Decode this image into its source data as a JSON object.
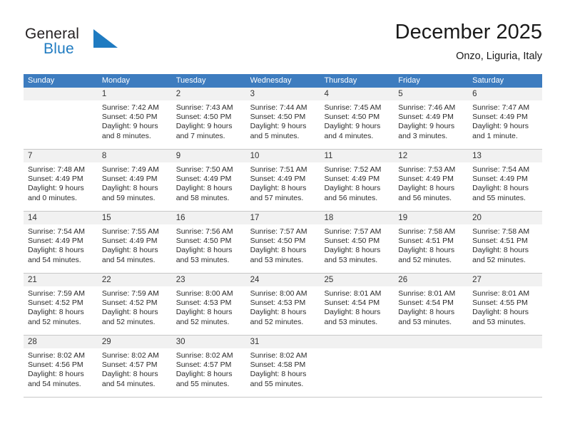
{
  "brand": {
    "name_top": "General",
    "name_bottom": "Blue",
    "mark": "triangle-logo-icon",
    "color_dark": "#231f20",
    "color_blue": "#1f7bc1"
  },
  "header": {
    "title": "December 2025",
    "subtitle": "Onzo, Liguria, Italy"
  },
  "theme": {
    "header_bg": "#3d7cbf",
    "header_text": "#ffffff",
    "daynum_bg": "#f1f1f1",
    "grid_line": "#c8c8c8"
  },
  "weekdays": [
    "Sunday",
    "Monday",
    "Tuesday",
    "Wednesday",
    "Thursday",
    "Friday",
    "Saturday"
  ],
  "weeks": [
    {
      "days": [
        {
          "num": "",
          "lines": [
            "",
            "",
            "",
            ""
          ]
        },
        {
          "num": "1",
          "lines": [
            "Sunrise: 7:42 AM",
            "Sunset: 4:50 PM",
            "Daylight: 9 hours",
            "and 8 minutes."
          ]
        },
        {
          "num": "2",
          "lines": [
            "Sunrise: 7:43 AM",
            "Sunset: 4:50 PM",
            "Daylight: 9 hours",
            "and 7 minutes."
          ]
        },
        {
          "num": "3",
          "lines": [
            "Sunrise: 7:44 AM",
            "Sunset: 4:50 PM",
            "Daylight: 9 hours",
            "and 5 minutes."
          ]
        },
        {
          "num": "4",
          "lines": [
            "Sunrise: 7:45 AM",
            "Sunset: 4:50 PM",
            "Daylight: 9 hours",
            "and 4 minutes."
          ]
        },
        {
          "num": "5",
          "lines": [
            "Sunrise: 7:46 AM",
            "Sunset: 4:49 PM",
            "Daylight: 9 hours",
            "and 3 minutes."
          ]
        },
        {
          "num": "6",
          "lines": [
            "Sunrise: 7:47 AM",
            "Sunset: 4:49 PM",
            "Daylight: 9 hours",
            "and 1 minute."
          ]
        }
      ]
    },
    {
      "days": [
        {
          "num": "7",
          "lines": [
            "Sunrise: 7:48 AM",
            "Sunset: 4:49 PM",
            "Daylight: 9 hours",
            "and 0 minutes."
          ]
        },
        {
          "num": "8",
          "lines": [
            "Sunrise: 7:49 AM",
            "Sunset: 4:49 PM",
            "Daylight: 8 hours",
            "and 59 minutes."
          ]
        },
        {
          "num": "9",
          "lines": [
            "Sunrise: 7:50 AM",
            "Sunset: 4:49 PM",
            "Daylight: 8 hours",
            "and 58 minutes."
          ]
        },
        {
          "num": "10",
          "lines": [
            "Sunrise: 7:51 AM",
            "Sunset: 4:49 PM",
            "Daylight: 8 hours",
            "and 57 minutes."
          ]
        },
        {
          "num": "11",
          "lines": [
            "Sunrise: 7:52 AM",
            "Sunset: 4:49 PM",
            "Daylight: 8 hours",
            "and 56 minutes."
          ]
        },
        {
          "num": "12",
          "lines": [
            "Sunrise: 7:53 AM",
            "Sunset: 4:49 PM",
            "Daylight: 8 hours",
            "and 56 minutes."
          ]
        },
        {
          "num": "13",
          "lines": [
            "Sunrise: 7:54 AM",
            "Sunset: 4:49 PM",
            "Daylight: 8 hours",
            "and 55 minutes."
          ]
        }
      ]
    },
    {
      "days": [
        {
          "num": "14",
          "lines": [
            "Sunrise: 7:54 AM",
            "Sunset: 4:49 PM",
            "Daylight: 8 hours",
            "and 54 minutes."
          ]
        },
        {
          "num": "15",
          "lines": [
            "Sunrise: 7:55 AM",
            "Sunset: 4:49 PM",
            "Daylight: 8 hours",
            "and 54 minutes."
          ]
        },
        {
          "num": "16",
          "lines": [
            "Sunrise: 7:56 AM",
            "Sunset: 4:50 PM",
            "Daylight: 8 hours",
            "and 53 minutes."
          ]
        },
        {
          "num": "17",
          "lines": [
            "Sunrise: 7:57 AM",
            "Sunset: 4:50 PM",
            "Daylight: 8 hours",
            "and 53 minutes."
          ]
        },
        {
          "num": "18",
          "lines": [
            "Sunrise: 7:57 AM",
            "Sunset: 4:50 PM",
            "Daylight: 8 hours",
            "and 53 minutes."
          ]
        },
        {
          "num": "19",
          "lines": [
            "Sunrise: 7:58 AM",
            "Sunset: 4:51 PM",
            "Daylight: 8 hours",
            "and 52 minutes."
          ]
        },
        {
          "num": "20",
          "lines": [
            "Sunrise: 7:58 AM",
            "Sunset: 4:51 PM",
            "Daylight: 8 hours",
            "and 52 minutes."
          ]
        }
      ]
    },
    {
      "days": [
        {
          "num": "21",
          "lines": [
            "Sunrise: 7:59 AM",
            "Sunset: 4:52 PM",
            "Daylight: 8 hours",
            "and 52 minutes."
          ]
        },
        {
          "num": "22",
          "lines": [
            "Sunrise: 7:59 AM",
            "Sunset: 4:52 PM",
            "Daylight: 8 hours",
            "and 52 minutes."
          ]
        },
        {
          "num": "23",
          "lines": [
            "Sunrise: 8:00 AM",
            "Sunset: 4:53 PM",
            "Daylight: 8 hours",
            "and 52 minutes."
          ]
        },
        {
          "num": "24",
          "lines": [
            "Sunrise: 8:00 AM",
            "Sunset: 4:53 PM",
            "Daylight: 8 hours",
            "and 52 minutes."
          ]
        },
        {
          "num": "25",
          "lines": [
            "Sunrise: 8:01 AM",
            "Sunset: 4:54 PM",
            "Daylight: 8 hours",
            "and 53 minutes."
          ]
        },
        {
          "num": "26",
          "lines": [
            "Sunrise: 8:01 AM",
            "Sunset: 4:54 PM",
            "Daylight: 8 hours",
            "and 53 minutes."
          ]
        },
        {
          "num": "27",
          "lines": [
            "Sunrise: 8:01 AM",
            "Sunset: 4:55 PM",
            "Daylight: 8 hours",
            "and 53 minutes."
          ]
        }
      ]
    },
    {
      "days": [
        {
          "num": "28",
          "lines": [
            "Sunrise: 8:02 AM",
            "Sunset: 4:56 PM",
            "Daylight: 8 hours",
            "and 54 minutes."
          ]
        },
        {
          "num": "29",
          "lines": [
            "Sunrise: 8:02 AM",
            "Sunset: 4:57 PM",
            "Daylight: 8 hours",
            "and 54 minutes."
          ]
        },
        {
          "num": "30",
          "lines": [
            "Sunrise: 8:02 AM",
            "Sunset: 4:57 PM",
            "Daylight: 8 hours",
            "and 55 minutes."
          ]
        },
        {
          "num": "31",
          "lines": [
            "Sunrise: 8:02 AM",
            "Sunset: 4:58 PM",
            "Daylight: 8 hours",
            "and 55 minutes."
          ]
        },
        {
          "num": "",
          "lines": [
            "",
            "",
            "",
            ""
          ]
        },
        {
          "num": "",
          "lines": [
            "",
            "",
            "",
            ""
          ]
        },
        {
          "num": "",
          "lines": [
            "",
            "",
            "",
            ""
          ]
        }
      ]
    }
  ]
}
